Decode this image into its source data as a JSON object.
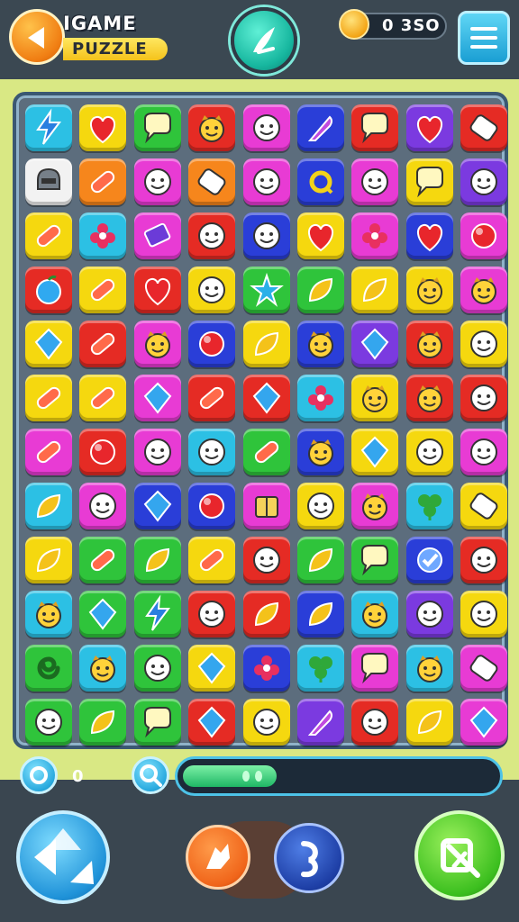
{
  "header": {
    "title_line1": "IGAME",
    "title_line2": "PUZZLE",
    "coins": "0 3SO"
  },
  "status": {
    "moves_value": "0",
    "progress_fraction": 0.3
  },
  "colors": {
    "yellow": "#f5d80f",
    "red": "#e52b24",
    "green": "#2fc43b",
    "magenta": "#e83bd4",
    "blue": "#2a3ed8",
    "orange": "#f6861c",
    "cyan": "#2cc0e4",
    "purple": "#7b3ae0",
    "white": "#f2f2f2"
  },
  "grid": [
    [
      [
        "cyan",
        "lightning-icon"
      ],
      [
        "yellow",
        "heart-icon"
      ],
      [
        "green",
        "speech-bubble-icon"
      ],
      [
        "red",
        "face-icon"
      ],
      [
        "magenta",
        "smiley-icon"
      ],
      [
        "blue",
        "feather-icon"
      ],
      [
        "red",
        "speech-bubble-icon"
      ],
      [
        "purple",
        "heart-icon"
      ],
      [
        "red",
        "tag-icon"
      ]
    ],
    [
      [
        "white",
        "helmet-icon"
      ],
      [
        "orange",
        "bandage-icon"
      ],
      [
        "magenta",
        "smiley-icon"
      ],
      [
        "orange",
        "tag-icon"
      ],
      [
        "magenta",
        "smiley-icon"
      ],
      [
        "blue",
        "ring-icon"
      ],
      [
        "magenta",
        "smiley-icon"
      ],
      [
        "yellow",
        "speech-bubble-icon"
      ],
      [
        "purple",
        "smiley-icon"
      ]
    ],
    [
      [
        "yellow",
        "bandage-icon"
      ],
      [
        "cyan",
        "flower-icon"
      ],
      [
        "magenta",
        "book-icon"
      ],
      [
        "red",
        "smiley-icon"
      ],
      [
        "blue",
        "smiley-icon"
      ],
      [
        "yellow",
        "heart-icon"
      ],
      [
        "magenta",
        "flower-icon"
      ],
      [
        "blue",
        "heart-icon"
      ],
      [
        "magenta",
        "ball-icon"
      ]
    ],
    [
      [
        "red",
        "apple-icon"
      ],
      [
        "yellow",
        "bandage-icon"
      ],
      [
        "red",
        "heart-icon"
      ],
      [
        "yellow",
        "smiley-icon"
      ],
      [
        "green",
        "star-icon"
      ],
      [
        "green",
        "leaf-icon"
      ],
      [
        "yellow",
        "leaf-icon"
      ],
      [
        "yellow",
        "face-icon"
      ],
      [
        "magenta",
        "face-icon"
      ]
    ],
    [
      [
        "yellow",
        "gem-icon"
      ],
      [
        "red",
        "bandage-icon"
      ],
      [
        "magenta",
        "face-icon"
      ],
      [
        "blue",
        "ball-icon"
      ],
      [
        "yellow",
        "leaf-icon"
      ],
      [
        "blue",
        "face-icon"
      ],
      [
        "purple",
        "gem-icon"
      ],
      [
        "red",
        "face-icon"
      ],
      [
        "yellow",
        "smiley-icon"
      ]
    ],
    [
      [
        "yellow",
        "bandage-icon"
      ],
      [
        "yellow",
        "bandage-icon"
      ],
      [
        "magenta",
        "gem-icon"
      ],
      [
        "red",
        "bandage-icon"
      ],
      [
        "red",
        "gem-icon"
      ],
      [
        "cyan",
        "flower-icon"
      ],
      [
        "yellow",
        "face-icon"
      ],
      [
        "red",
        "face-icon"
      ],
      [
        "red",
        "smiley-icon"
      ]
    ],
    [
      [
        "magenta",
        "bandage-icon"
      ],
      [
        "red",
        "ball-icon"
      ],
      [
        "magenta",
        "smiley-icon"
      ],
      [
        "cyan",
        "smiley-icon"
      ],
      [
        "green",
        "bandage-icon"
      ],
      [
        "blue",
        "face-icon"
      ],
      [
        "yellow",
        "gem-icon"
      ],
      [
        "yellow",
        "smiley-icon"
      ],
      [
        "magenta",
        "smiley-icon"
      ]
    ],
    [
      [
        "cyan",
        "leaf-icon"
      ],
      [
        "magenta",
        "smiley-icon"
      ],
      [
        "blue",
        "gem-icon"
      ],
      [
        "blue",
        "ball-icon"
      ],
      [
        "magenta",
        "box-icon"
      ],
      [
        "yellow",
        "smiley-icon"
      ],
      [
        "magenta",
        "face-icon"
      ],
      [
        "cyan",
        "clover-icon"
      ],
      [
        "yellow",
        "tag-icon"
      ]
    ],
    [
      [
        "yellow",
        "leaf-icon"
      ],
      [
        "green",
        "bandage-icon"
      ],
      [
        "green",
        "leaf-icon"
      ],
      [
        "yellow",
        "bandage-icon"
      ],
      [
        "red",
        "smiley-icon"
      ],
      [
        "green",
        "leaf-icon"
      ],
      [
        "green",
        "speech-bubble-icon"
      ],
      [
        "blue",
        "check-icon"
      ],
      [
        "red",
        "smiley-icon"
      ]
    ],
    [
      [
        "cyan",
        "face-icon"
      ],
      [
        "green",
        "gem-icon"
      ],
      [
        "green",
        "lightning-icon"
      ],
      [
        "red",
        "smiley-icon"
      ],
      [
        "red",
        "leaf-icon"
      ],
      [
        "blue",
        "leaf-icon"
      ],
      [
        "cyan",
        "face-icon"
      ],
      [
        "purple",
        "smiley-icon"
      ],
      [
        "yellow",
        "smiley-icon"
      ]
    ],
    [
      [
        "green",
        "swirl-icon"
      ],
      [
        "cyan",
        "face-icon"
      ],
      [
        "green",
        "smiley-icon"
      ],
      [
        "yellow",
        "gem-icon"
      ],
      [
        "blue",
        "flower-icon"
      ],
      [
        "cyan",
        "clover-icon"
      ],
      [
        "magenta",
        "speech-bubble-icon"
      ],
      [
        "cyan",
        "face-icon"
      ],
      [
        "magenta",
        "tag-icon"
      ]
    ],
    [
      [
        "green",
        "smiley-icon"
      ],
      [
        "green",
        "leaf-icon"
      ],
      [
        "green",
        "speech-bubble-icon"
      ],
      [
        "red",
        "gem-icon"
      ],
      [
        "yellow",
        "smiley-icon"
      ],
      [
        "purple",
        "feather-icon"
      ],
      [
        "red",
        "smiley-icon"
      ],
      [
        "yellow",
        "leaf-icon"
      ],
      [
        "magenta",
        "gem-icon"
      ]
    ]
  ]
}
